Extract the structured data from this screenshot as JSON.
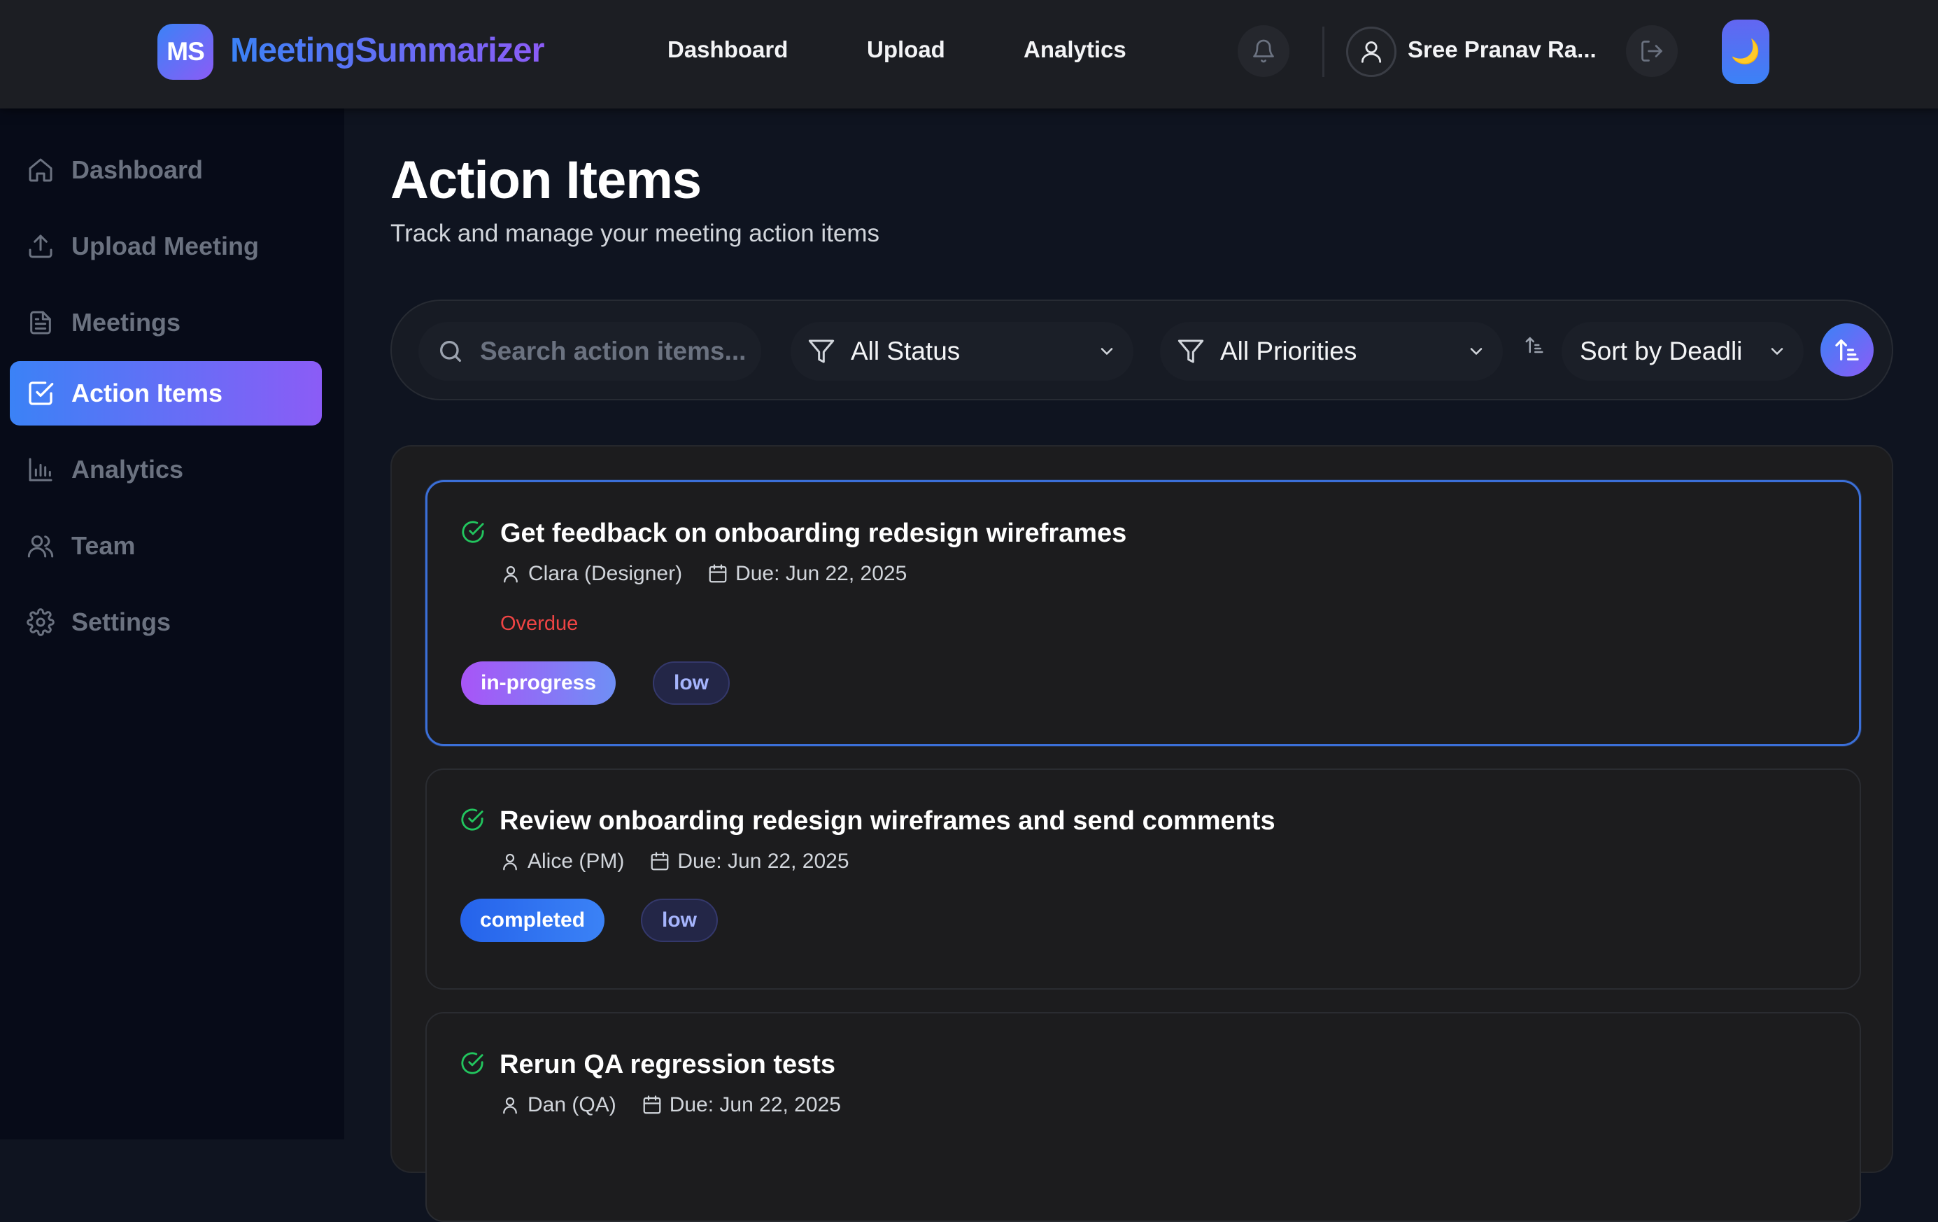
{
  "header": {
    "logo_initials": "MS",
    "app_name": "MeetingSummarizer",
    "nav": [
      "Dashboard",
      "Upload",
      "Analytics"
    ],
    "user_name": "Sree Pranav Ra...",
    "theme_icon": "🌙"
  },
  "sidebar": {
    "items": [
      {
        "label": "Dashboard",
        "icon": "home-icon"
      },
      {
        "label": "Upload Meeting",
        "icon": "upload-icon"
      },
      {
        "label": "Meetings",
        "icon": "document-icon"
      },
      {
        "label": "Action Items",
        "icon": "checkbox-icon",
        "active": true
      },
      {
        "label": "Analytics",
        "icon": "bar-chart-icon"
      },
      {
        "label": "Team",
        "icon": "users-icon"
      },
      {
        "label": "Settings",
        "icon": "gear-icon"
      }
    ]
  },
  "main": {
    "title": "Action Items",
    "subtitle": "Track and manage your meeting action items"
  },
  "filters": {
    "search_placeholder": "Search action items...",
    "status_value": "All Status",
    "priority_value": "All Priorities",
    "sort_value": "Sort by Deadli"
  },
  "action_items": [
    {
      "title": "Get feedback on onboarding redesign wireframes",
      "assignee": "Clara (Designer)",
      "due": "Due: Jun 22, 2025",
      "overdue_label": "Overdue",
      "status": "in-progress",
      "priority": "low"
    },
    {
      "title": "Review onboarding redesign wireframes and send comments",
      "assignee": "Alice (PM)",
      "due": "Due: Jun 22, 2025",
      "status": "completed",
      "priority": "low"
    },
    {
      "title": "Rerun QA regression tests",
      "assignee": "Dan (QA)",
      "due": "Due: Jun 22, 2025"
    }
  ],
  "colors": {
    "accent_blue": "#3b82f6",
    "accent_purple": "#8b5cf6",
    "overdue_red": "#ef4444",
    "check_green": "#22c55e"
  }
}
